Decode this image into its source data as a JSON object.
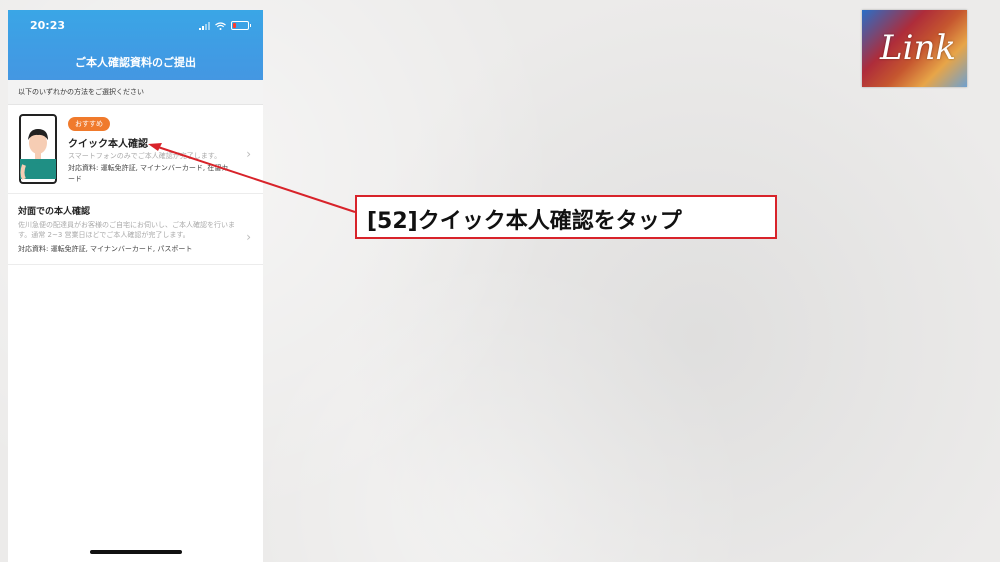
{
  "status_bar": {
    "time": "20:23"
  },
  "header": {
    "title": "ご本人確認資料のご提出"
  },
  "subheader": {
    "text": "以下のいずれかの方法をご選択ください"
  },
  "options": [
    {
      "badge": "おすすめ",
      "title": "クイック本人確認",
      "description": "スマートフォンのみでご本人確認が完了します。",
      "documents": "対応資料: 運転免許証, マイナンバーカード, 在留カード"
    },
    {
      "title": "対面での本人確認",
      "description": "佐川急便の配達員がお客様のご自宅にお伺いし、ご本人確認を行います。通常 2~3 営業日ほどでご本人確認が完了します。",
      "documents": "対応資料: 運転免許証, マイナンバーカード, パスポート"
    }
  ],
  "callout": {
    "text": "[52]クイック本人確認をタップ",
    "border_color": "#d8232a"
  },
  "logo": {
    "text": "Link"
  },
  "colors": {
    "header_blue": "#3f9de4",
    "badge_orange": "#f07a2c",
    "arrow_red": "#d8232a"
  }
}
